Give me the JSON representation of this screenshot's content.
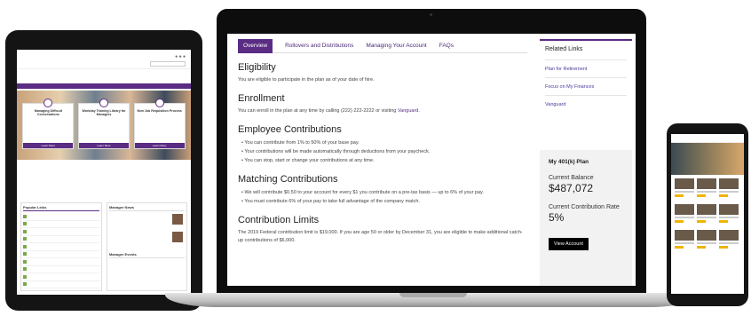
{
  "laptop": {
    "tabs": [
      {
        "label": "Overview",
        "active": true
      },
      {
        "label": "Rollovers and Distributions",
        "active": false
      },
      {
        "label": "Managing Your Account",
        "active": false
      },
      {
        "label": "FAQs",
        "active": false
      }
    ],
    "sections": {
      "eligibility": {
        "heading": "Eligibility",
        "text": "You are eligible to participate in the plan as of your date of hire."
      },
      "enrollment": {
        "heading": "Enrollment",
        "text": "You can enroll in the plan at any time by calling (222) 222-2222 or visiting",
        "link": "Vanguard."
      },
      "employee_contributions": {
        "heading": "Employee Contributions",
        "bullets": [
          "You can contribute from 1% to 50% of your base pay.",
          "Your contributions will be made automatically through deductions from your paycheck.",
          "You can stop, start or change your contributions at any time."
        ]
      },
      "matching_contributions": {
        "heading": "Matching Contributions",
        "bullets": [
          "We will contribute $0.50 to your account for every $1 you contribute on a pre-tax basis — up to 6% of your pay.",
          "You must contribute 6% of your pay to take full advantage of the company match."
        ]
      },
      "contribution_limits": {
        "heading": "Contribution Limits",
        "text": "The 2019 Federal contribution limit is $19,000. If you are age 50 or older by December 31, you are eligible to make additional catch-up contributions of $6,000."
      }
    },
    "related_links": {
      "title": "Related Links",
      "links": [
        "Plan for Retirement",
        "Focus on My Finances",
        "Vanguard"
      ]
    },
    "plan": {
      "title": "My 401(k) Plan",
      "balance_label": "Current Balance",
      "balance_value": "$487,072",
      "rate_label": "Current Contribution Rate",
      "rate_value": "5%",
      "button_label": "View Account"
    }
  },
  "tablet": {
    "cards": [
      {
        "title": "Managing Difficult Conversations"
      },
      {
        "title": "Workday Training Library for Managers"
      },
      {
        "title": "New Job Requisition Process"
      }
    ],
    "card_button": "Learn More",
    "links_title": "Popular Links",
    "news_title": "Manager News",
    "news2_title": "Manager Events"
  },
  "colors": {
    "brand_purple": "#5b2c83",
    "device_black": "#141414",
    "button_black": "#000000"
  }
}
